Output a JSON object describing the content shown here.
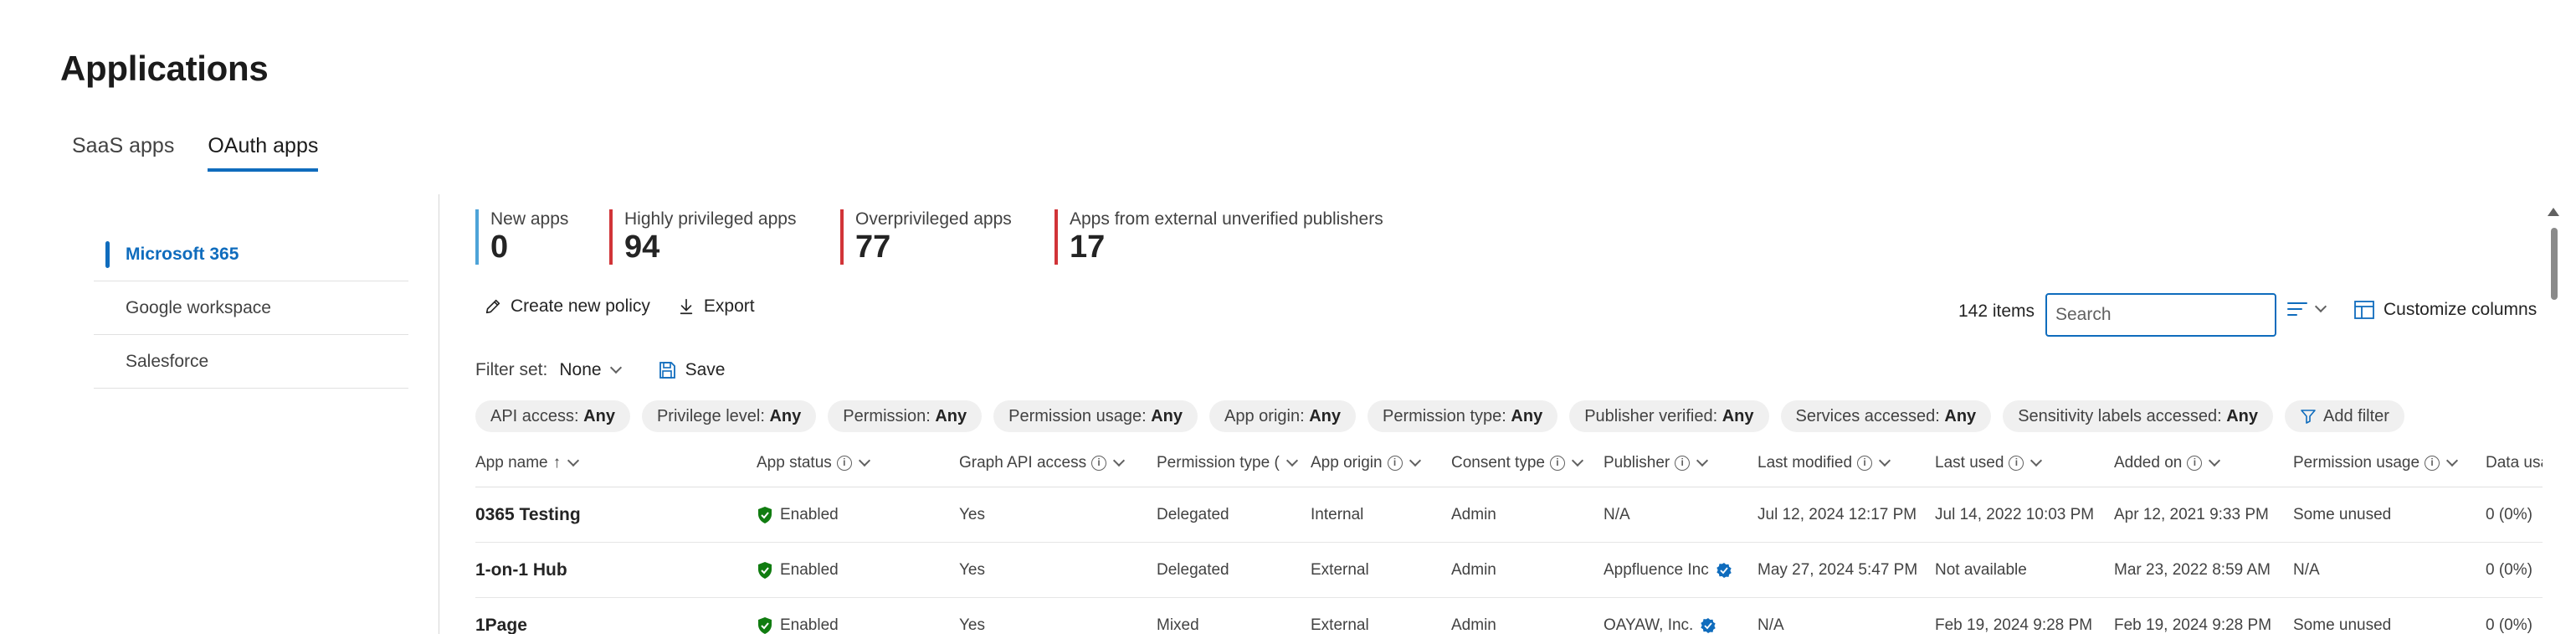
{
  "page": {
    "title": "Applications"
  },
  "top_tabs": [
    {
      "label": "SaaS apps",
      "active": false
    },
    {
      "label": "OAuth apps",
      "active": true
    }
  ],
  "side_nav": [
    {
      "label": "Microsoft 365",
      "active": true
    },
    {
      "label": "Google workspace",
      "active": false
    },
    {
      "label": "Salesforce",
      "active": false
    }
  ],
  "stats": [
    {
      "label": "New apps",
      "value": "0",
      "color": "#4da3d8"
    },
    {
      "label": "Highly privileged apps",
      "value": "94",
      "color": "#d13438"
    },
    {
      "label": "Overprivileged apps",
      "value": "77",
      "color": "#d13438"
    },
    {
      "label": "Apps from external unverified publishers",
      "value": "17",
      "color": "#d13438"
    }
  ],
  "toolbar": {
    "create_policy": "Create new policy",
    "export": "Export",
    "items_count": "142 items",
    "search_placeholder": "Search",
    "customize_columns": "Customize columns"
  },
  "filter_set": {
    "label": "Filter set:",
    "value": "None",
    "save": "Save"
  },
  "filter_chips": [
    {
      "label": "API access:",
      "value": "Any"
    },
    {
      "label": "Privilege level:",
      "value": "Any"
    },
    {
      "label": "Permission:",
      "value": "Any"
    },
    {
      "label": "Permission usage:",
      "value": "Any"
    },
    {
      "label": "App origin:",
      "value": "Any"
    },
    {
      "label": "Permission type:",
      "value": "Any"
    },
    {
      "label": "Publisher verified:",
      "value": "Any"
    },
    {
      "label": "Services accessed:",
      "value": "Any"
    },
    {
      "label": "Sensitivity labels accessed:",
      "value": "Any"
    }
  ],
  "add_filter": "Add filter",
  "table": {
    "columns": [
      {
        "label": "App name",
        "sort": "↑",
        "info": false
      },
      {
        "label": "App status",
        "info": true
      },
      {
        "label": "Graph API access",
        "info": true
      },
      {
        "label": "Permission type (",
        "info": false
      },
      {
        "label": "App origin",
        "info": true
      },
      {
        "label": "Consent type",
        "info": true
      },
      {
        "label": "Publisher",
        "info": true
      },
      {
        "label": "Last modified",
        "info": true
      },
      {
        "label": "Last used",
        "info": true
      },
      {
        "label": "Added on",
        "info": true
      },
      {
        "label": "Permission usage",
        "info": true
      },
      {
        "label": "Data usa",
        "info": false
      }
    ],
    "rows": [
      [
        "0365 Testing",
        "Enabled",
        "Yes",
        "Delegated",
        "Internal",
        "Admin",
        "N/A",
        "Jul 12, 2024 12:17 PM",
        "Jul 14, 2022 10:03 PM",
        "Apr 12, 2021 9:33 PM",
        "Some unused",
        "0 (0%)"
      ],
      [
        "1-on-1 Hub",
        "Enabled",
        "Yes",
        "Delegated",
        "External",
        "Admin",
        "Appfluence Inc",
        "May 27, 2024 5:47 PM",
        "Not available",
        "Mar 23, 2022 8:59 AM",
        "N/A",
        "0 (0%)"
      ],
      [
        "1Page",
        "Enabled",
        "Yes",
        "Mixed",
        "External",
        "Admin",
        "OAYAW, Inc.",
        "N/A",
        "Feb 19, 2024 9:28 PM",
        "Feb 19, 2024 9:28 PM",
        "Some unused",
        "0 (0%)"
      ]
    ],
    "publisher_verified": [
      false,
      true,
      true
    ],
    "status_color": "#107c10",
    "verified_color": "#0f6cbd"
  }
}
